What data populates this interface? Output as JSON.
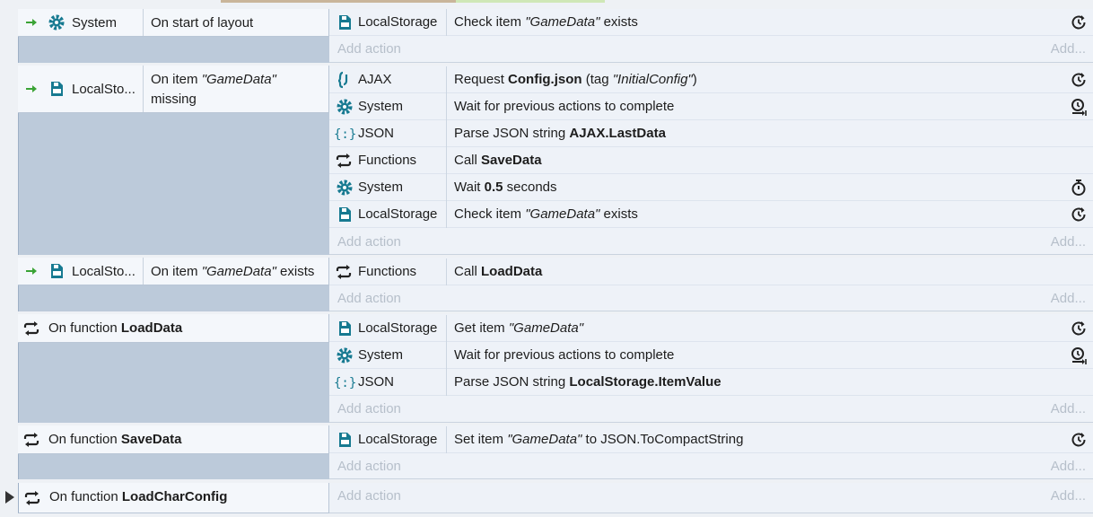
{
  "events": [
    {
      "condition": {
        "object": "System",
        "text": "On start of layout"
      },
      "actions": [
        {
          "object": "LocalStorage",
          "pre": "Check item ",
          "q1": "\"",
          "it": "GameData",
          "q2": "\"",
          "post": " exists",
          "end_icon": "async-icon"
        }
      ],
      "add_action": "Add action",
      "add_short": "Add..."
    },
    {
      "condition": {
        "object": "LocalSto...",
        "line1_pre": "On item ",
        "line1_it": "\"GameData\"",
        "line2": "missing"
      },
      "actions": [
        {
          "object": "AJAX",
          "pre": "Request ",
          "bold": "Config.json",
          "mid": " (tag ",
          "it": "\"InitialConfig\"",
          "post": ")",
          "end_icon": "async-icon"
        },
        {
          "object": "System",
          "text": "Wait for previous actions to complete",
          "end_icon": "wait-complete-icon"
        },
        {
          "object": "JSON",
          "pre": "Parse JSON string ",
          "bold": "AJAX.LastData"
        },
        {
          "object": "Functions",
          "pre": "Call ",
          "bold": "SaveData"
        },
        {
          "object": "System",
          "pre": "Wait ",
          "bold": "0.5",
          "post": " seconds",
          "end_icon": "stopwatch-icon"
        },
        {
          "object": "LocalStorage",
          "pre": "Check item ",
          "it": "\"GameData\"",
          "post": " exists",
          "end_icon": "async-icon"
        }
      ],
      "add_action": "Add action",
      "add_short": "Add..."
    },
    {
      "condition": {
        "object": "LocalSto...",
        "pre": "On item ",
        "it": "\"GameData\"",
        "post": " exists"
      },
      "actions": [
        {
          "object": "Functions",
          "pre": "Call ",
          "bold": "LoadData"
        }
      ],
      "add_action": "Add action",
      "add_short": "Add..."
    },
    {
      "function": {
        "pre": "On function ",
        "bold": "LoadData"
      },
      "actions": [
        {
          "object": "LocalStorage",
          "pre": "Get item ",
          "it": "\"GameData\"",
          "end_icon": "async-icon"
        },
        {
          "object": "System",
          "text": "Wait for previous actions to complete",
          "end_icon": "wait-complete-icon"
        },
        {
          "object": "JSON",
          "pre": "Parse JSON string ",
          "bold": "LocalStorage.ItemValue"
        }
      ],
      "add_action": "Add action",
      "add_short": "Add..."
    },
    {
      "function": {
        "pre": "On function ",
        "bold": "SaveData"
      },
      "actions": [
        {
          "object": "LocalStorage",
          "pre": "Set item ",
          "it": "\"GameData\"",
          "post": " to JSON.ToCompactString",
          "end_icon": "async-icon"
        }
      ],
      "add_action": "Add action",
      "add_short": "Add..."
    },
    {
      "function": {
        "pre": "On function ",
        "bold": "LoadCharConfig"
      },
      "add_action": "Add action",
      "add_short": "Add..."
    }
  ],
  "colors": {
    "accent_green": "#3aa335",
    "icon_teal": "#177a91",
    "icon_blue": "#2f6fb6"
  }
}
